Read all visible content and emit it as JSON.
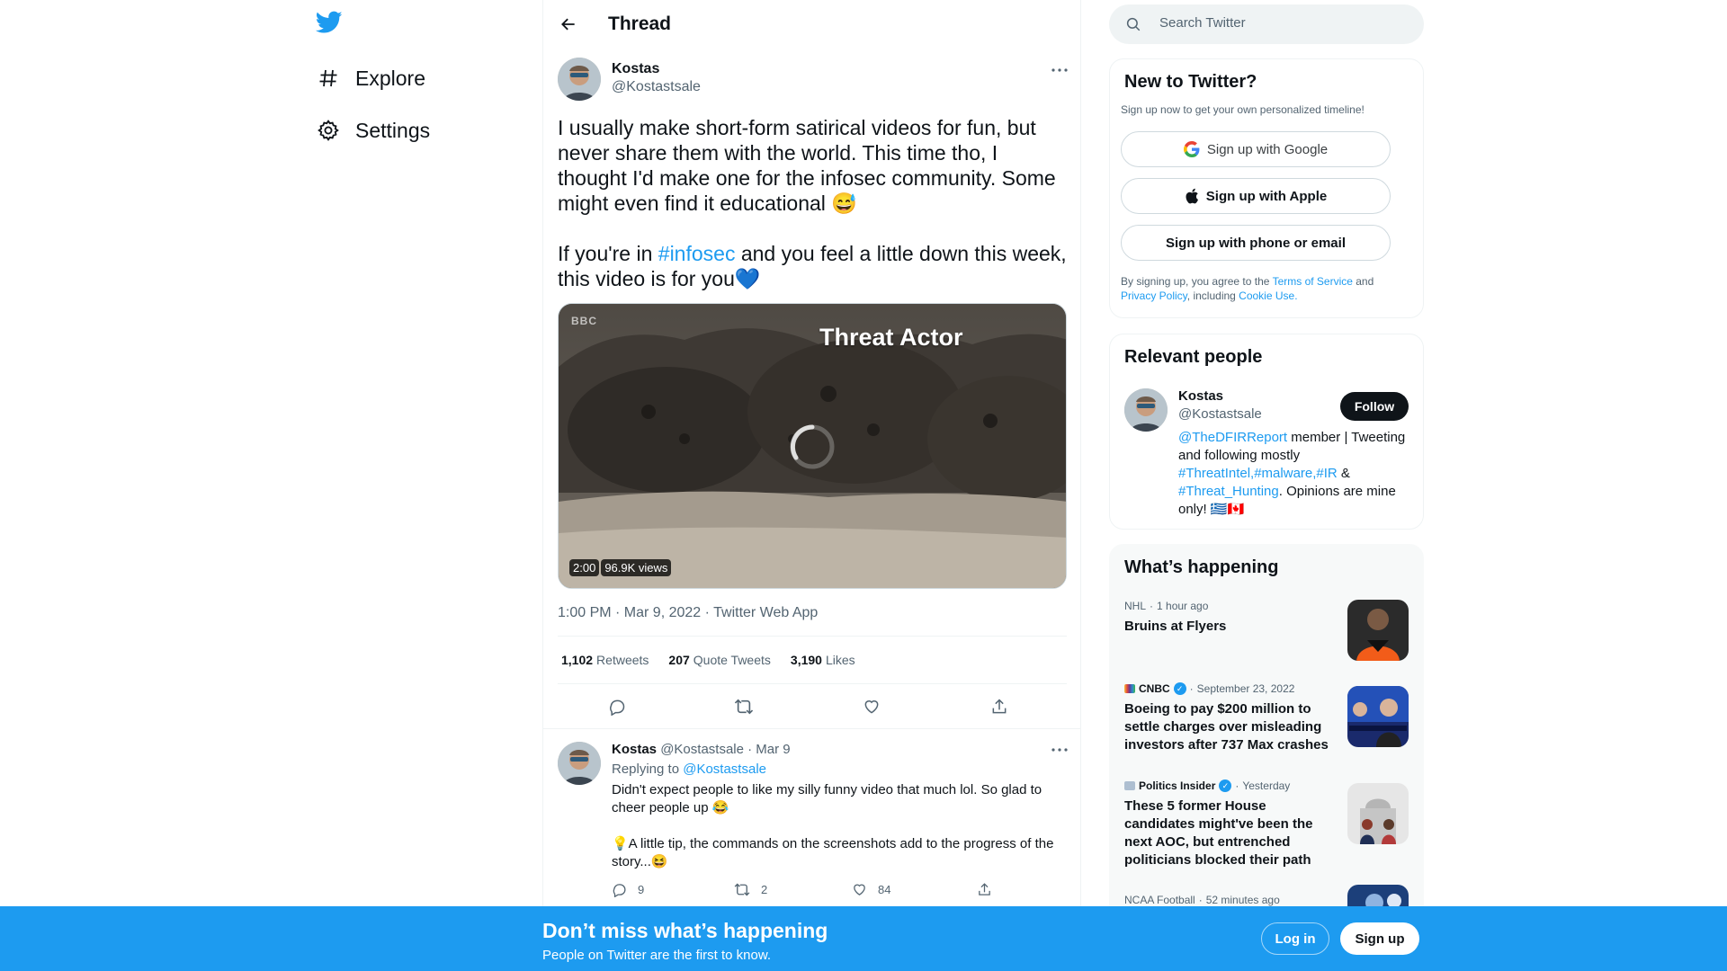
{
  "colors": {
    "accent": "#1d9bf0",
    "text": "#0f1419",
    "muted": "#536471",
    "bottom_bar": "#1d9bf0"
  },
  "nav": {
    "logo_icon": "twitter-bird-icon",
    "items": [
      {
        "label": "Explore",
        "icon": "hashtag-icon"
      },
      {
        "label": "Settings",
        "icon": "gear-icon"
      }
    ]
  },
  "header": {
    "title": "Thread",
    "back_icon": "back-arrow-icon"
  },
  "tweet": {
    "name": "Kostas",
    "handle": "@Kostastsale",
    "text_line1": "I usually make short-form satirical videos for fun, but never share them with the world. This time tho, I thought I'd make one for the infosec community. Some might even find it educational 😅",
    "text_pre": "If you're in ",
    "hashtag": "#infosec",
    "text_post": " and you feel a little down this week, this video is for you💙",
    "media": {
      "caption": "Threat Actor",
      "channel_mark": "BBC",
      "duration": "2:00",
      "views": "96.9K views"
    },
    "meta": "1:00 PM · Mar 9, 2022 · Twitter Web App",
    "stats": [
      {
        "num": "1,102",
        "label": "Retweets"
      },
      {
        "num": "207",
        "label": "Quote Tweets"
      },
      {
        "num": "3,190",
        "label": "Likes"
      }
    ]
  },
  "reply": {
    "name": "Kostas",
    "handle_date": "@Kostastsale · Mar 9",
    "replying_prefix": "Replying to ",
    "replying_handle": "@Kostastsale",
    "text": "Didn't expect people to like my silly funny video that much lol. So glad to cheer people up 😂\n\n💡A little tip, the commands on the screenshots add to the progress of the story...😆",
    "counts": {
      "replies": "9",
      "retweets": "2",
      "likes": "84"
    }
  },
  "search": {
    "placeholder": "Search Twitter"
  },
  "new_to_twitter": {
    "title": "New to Twitter?",
    "subtitle": "Sign up now to get your own personalized timeline!",
    "google": "Sign up with Google",
    "apple": "Sign up with Apple",
    "phone": "Sign up with phone or email",
    "terms_1": "By signing up, you agree to the ",
    "terms_link": "Terms of Service",
    "terms_2": " and ",
    "privacy_link": "Privacy Policy",
    "terms_3": ", including ",
    "cookie_link": "Cookie Use",
    "terms_4": "."
  },
  "relevant_people": {
    "title": "Relevant people",
    "name": "Kostas",
    "handle": "@Kostastsale",
    "follow": "Follow",
    "bio_link1": "@TheDFIRReport",
    "bio_t1": " member | Tweeting and following mostly ",
    "bio_tag1": "#ThreatIntel",
    "bio_c1": ",",
    "bio_tag2": "#malware",
    "bio_c2": ",",
    "bio_tag3": "#IR",
    "bio_t2": " & ",
    "bio_tag4": "#Threat_Hunting",
    "bio_t3": ". Opinions are mine only! 🇬🇷🇨🇦"
  },
  "happening": {
    "title": "What’s happening",
    "trends": [
      {
        "source": "NHL",
        "time": "1 hour ago",
        "title": "Bruins at Flyers",
        "verified": false
      },
      {
        "source": "CNBC",
        "time": "September 23, 2022",
        "title": "Boeing to pay $200 million to settle charges over misleading investors after 737 Max crashes",
        "verified": true
      },
      {
        "source": "Politics Insider",
        "time": "Yesterday",
        "title": "These 5 former House candidates might've been the next AOC, but entrenched politicians blocked their path",
        "verified": true
      },
      {
        "source": "NCAA Football",
        "time": "52 minutes ago",
        "title": "",
        "verified": false
      }
    ]
  },
  "bottom_bar": {
    "title": "Don’t miss what’s happening",
    "subtitle": "People on Twitter are the first to know.",
    "login": "Log in",
    "signup": "Sign up"
  }
}
